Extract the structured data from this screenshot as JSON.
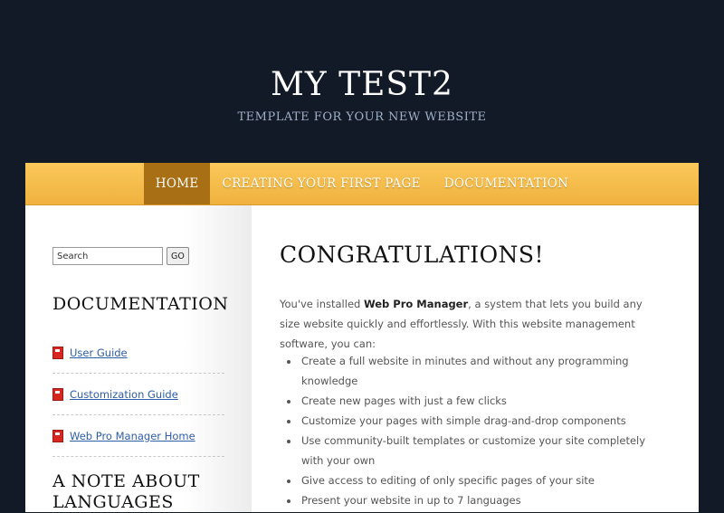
{
  "header": {
    "title": "MY TEST2",
    "tagline": "TEMPLATE FOR YOUR NEW WEBSITE"
  },
  "nav": {
    "items": [
      {
        "label": "HOME",
        "active": true
      },
      {
        "label": "CREATING YOUR FIRST PAGE",
        "active": false
      },
      {
        "label": "DOCUMENTATION",
        "active": false
      }
    ]
  },
  "sidebar": {
    "search": {
      "value": "Search",
      "button_label": "GO"
    },
    "documentation_heading": "DOCUMENTATION",
    "doc_links": [
      {
        "label": "User Guide",
        "icon": "pdf-icon"
      },
      {
        "label": "Customization Guide",
        "icon": "pdf-icon"
      },
      {
        "label": "Web Pro Manager Home",
        "icon": "pdf-icon"
      }
    ],
    "note_heading": "A NOTE ABOUT LANGUAGES"
  },
  "main": {
    "heading": "CONGRATULATIONS!",
    "intro_before": "You've installed ",
    "intro_bold": "Web Pro Manager",
    "intro_after": ", a system that lets you build any size website quickly and effortlessly. With this website management software, you can:",
    "features": [
      "Create a full website in minutes and without any programming knowledge",
      "Create new pages with just a few clicks",
      "Customize your pages with simple drag-and-drop components",
      "Use community-built templates or customize your site completely with your own",
      "Give access to editing of only specific pages of your site",
      "Present your website in up to 7 languages"
    ]
  },
  "colors": {
    "background": "#131a27",
    "nav_bar": "#f5bd4b",
    "nav_active": "#a86f15",
    "link": "#2d5ea8"
  }
}
